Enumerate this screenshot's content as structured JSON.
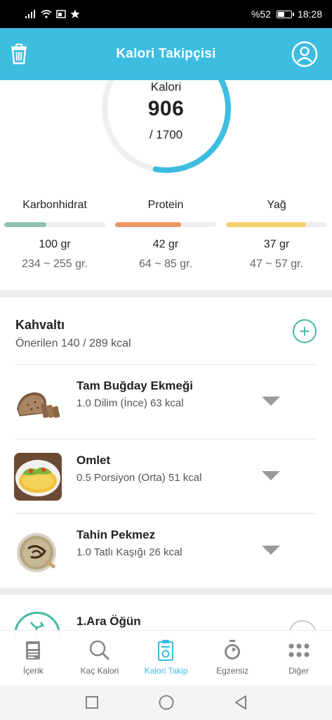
{
  "status_bar": {
    "battery": "%52",
    "battery_level": 0.52,
    "time": "18:28"
  },
  "header": {
    "title": "Kalori Takipçisi"
  },
  "calories": {
    "label": "Kalori",
    "value": "906",
    "target": "/ 1700",
    "progress": 0.533
  },
  "macros": [
    {
      "name": "Karbonhidrat",
      "amount": "100 gr",
      "range": "234 ~ 255 gr.",
      "fill": 0.42,
      "color": "#8fc1b5"
    },
    {
      "name": "Protein",
      "amount": "42 gr",
      "range": "64 ~ 85 gr.",
      "fill": 0.65,
      "color": "#f09466"
    },
    {
      "name": "Yağ",
      "amount": "37 gr",
      "range": "47 ~ 57 gr.",
      "fill": 0.79,
      "color": "#f3cf6a"
    }
  ],
  "meal": {
    "title": "Kahvaltı",
    "subtitle": "Önerilen 140 / 289 kcal",
    "add_symbol": "+",
    "foods": [
      {
        "name": "Tam Buğday Ekmeği",
        "detail": "1.0 Dilim (İnce) 63 kcal",
        "image": "bread-image"
      },
      {
        "name": "Omlet",
        "detail": "0.5 Porsiyon (Orta) 51 kcal",
        "image": "omelet-image"
      },
      {
        "name": "Tahin Pekmez",
        "detail": "1.0 Tatlı Kaşığı 26 kcal",
        "image": "tahini-image"
      }
    ]
  },
  "next_meal": {
    "title": "1.Ara Öğün"
  },
  "bottom_nav": [
    {
      "label": "İçerik",
      "icon": "document-icon",
      "active": false
    },
    {
      "label": "Kaç Kalori",
      "icon": "search-icon",
      "active": false
    },
    {
      "label": "Kalori Takip",
      "icon": "scale-icon",
      "active": true
    },
    {
      "label": "Egzersiz",
      "icon": "stopwatch-icon",
      "active": false
    },
    {
      "label": "Diğer",
      "icon": "grid-dots-icon",
      "active": false
    }
  ],
  "colors": {
    "accent": "#3dbde0",
    "green": "#44b8a2",
    "ring_track": "#efefef"
  }
}
